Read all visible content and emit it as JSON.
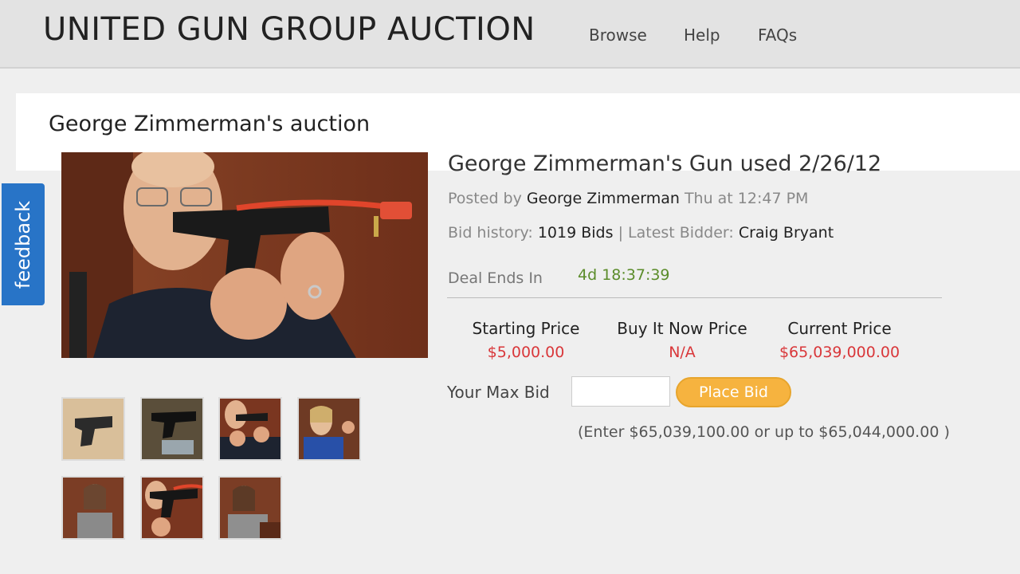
{
  "header": {
    "brand": "UNITED GUN GROUP AUCTION",
    "nav": [
      "Browse",
      "Help",
      "FAQs"
    ]
  },
  "page": {
    "title": "George Zimmerman's auction"
  },
  "feedback": {
    "label": "feedback",
    "color": "#2874c7"
  },
  "listing": {
    "title": "George Zimmerman's Gun used 2/26/12",
    "posted_prefix": "Posted by",
    "seller": "George Zimmerman",
    "posted_time": "Thu at 12:47 PM",
    "bid_history_label": "Bid history:",
    "bids": "1019 Bids",
    "separator": "|",
    "latest_bidder_label": "Latest Bidder:",
    "latest_bidder": "Craig Bryant",
    "deal_ends_label": "Deal Ends In",
    "countdown": "4d 18:37:39",
    "prices": {
      "starting_label": "Starting Price",
      "starting_value": "$5,000.00",
      "bin_label": "Buy It Now Price",
      "bin_value": "N/A",
      "current_label": "Current Price",
      "current_value": "$65,039,000.00"
    },
    "bid": {
      "max_bid_label": "Your Max Bid",
      "input_value": "",
      "button_label": "Place Bid",
      "hint": "(Enter $65,039,100.00 or up to $65,044,000.00 )"
    }
  },
  "colors": {
    "price_red": "#d9373a",
    "countdown_green": "#5b8c2a",
    "button_orange": "#f6b33f"
  }
}
